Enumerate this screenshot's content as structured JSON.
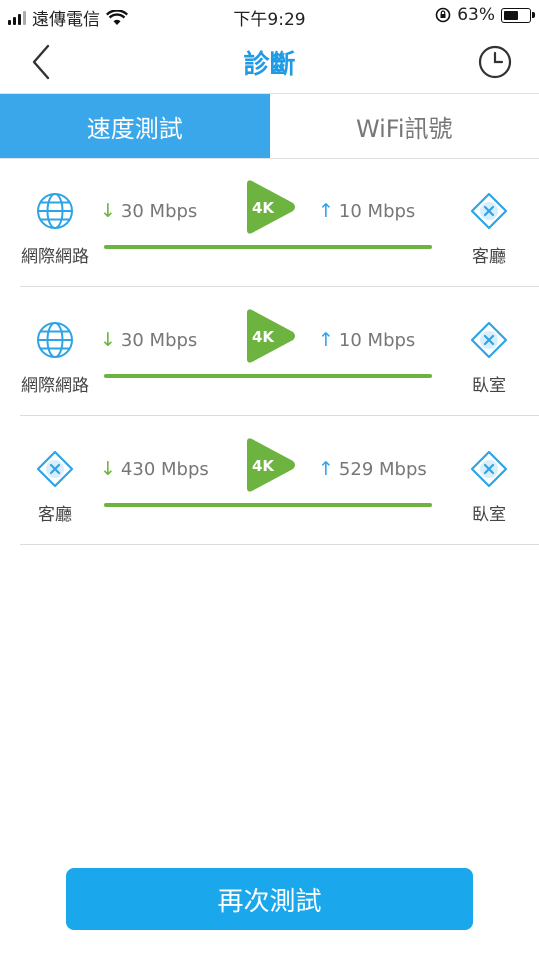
{
  "status": {
    "carrier": "遠傳電信",
    "time": "下午9:29",
    "battery": "63%",
    "battery_level": 0.63
  },
  "nav": {
    "title": "診斷",
    "back_icon": "chevron-left-icon",
    "history_icon": "clock-icon"
  },
  "tabs": [
    {
      "label": "速度測試",
      "active": true
    },
    {
      "label": "WiFi訊號",
      "active": false
    }
  ],
  "results": [
    {
      "left": {
        "label": "網際網路",
        "icon": "globe-icon"
      },
      "down": "30 Mbps",
      "up": "10 Mbps",
      "quality": "4K",
      "right": {
        "label": "客廳",
        "icon": "router-icon"
      }
    },
    {
      "left": {
        "label": "網際網路",
        "icon": "globe-icon"
      },
      "down": "30 Mbps",
      "up": "10 Mbps",
      "quality": "4K",
      "right": {
        "label": "臥室",
        "icon": "router-icon"
      }
    },
    {
      "left": {
        "label": "客廳",
        "icon": "router-icon"
      },
      "down": "430 Mbps",
      "up": "529 Mbps",
      "quality": "4K",
      "right": {
        "label": "臥室",
        "icon": "router-icon"
      }
    }
  ],
  "arrows": {
    "down": "↓",
    "up": "↑"
  },
  "colors": {
    "accent": "#1e9be4",
    "tab_active": "#3aa7ea",
    "good": "#6db33f",
    "button": "#1aa7ec"
  },
  "retest_label": "再次測試"
}
